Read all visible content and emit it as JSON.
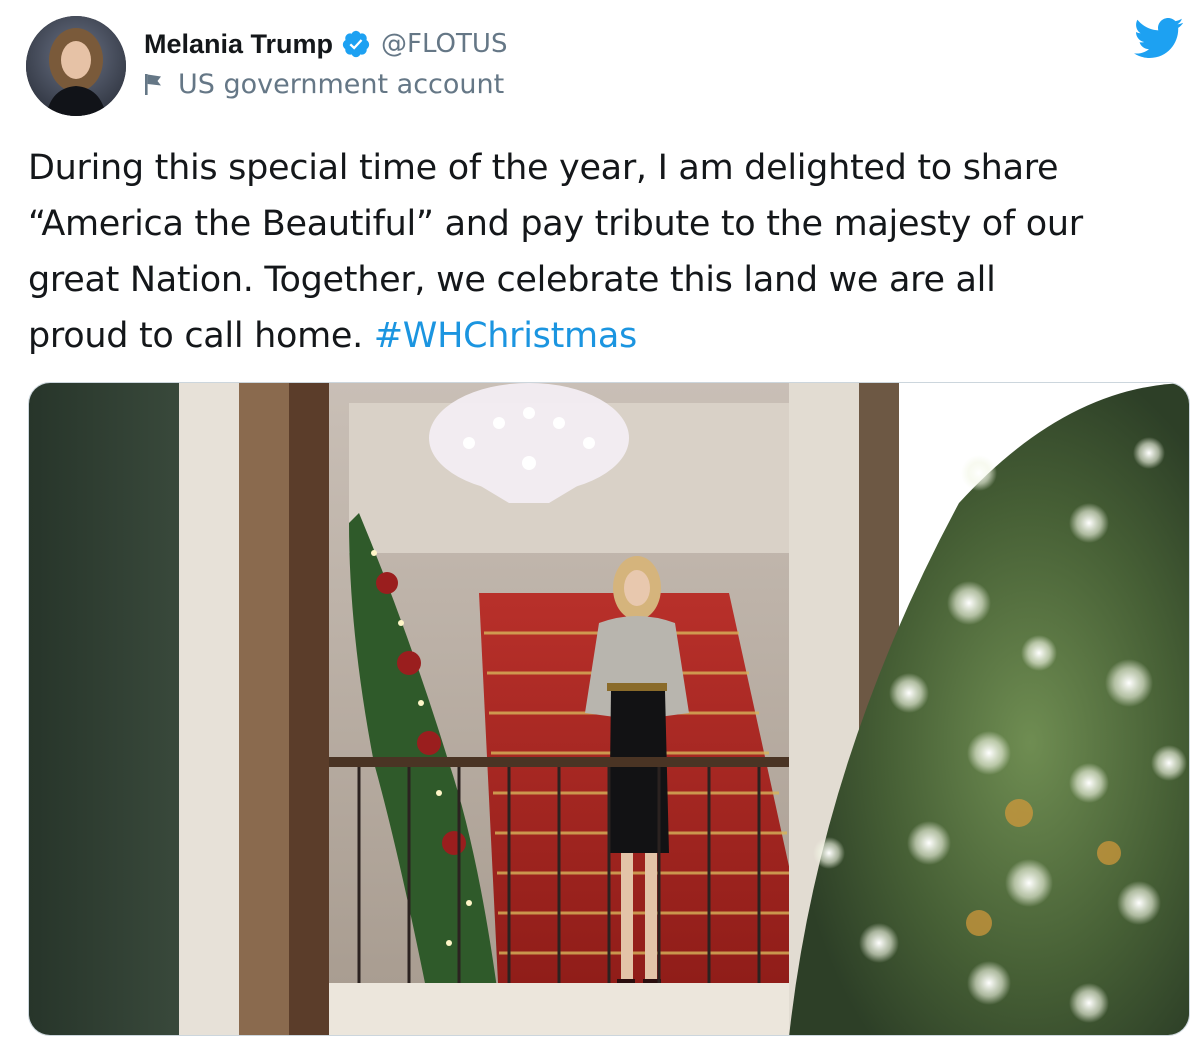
{
  "author": {
    "display_name": "Melania Trump",
    "handle": "@FLOTUS",
    "verified": true,
    "account_label": "US government account",
    "avatar": "avatar-photo"
  },
  "tweet": {
    "text_lines": [
      "During this special time of the year, I am delighted to share",
      "“America the Beautiful” and pay tribute to the majesty of our",
      "great Nation. Together, we celebrate this land we are all",
      "proud to call home. "
    ],
    "hashtag": "#WHChristmas"
  },
  "media": {
    "kind": "photo",
    "subject": "woman-on-grand-staircase"
  },
  "icons": {
    "verified": "verified-badge-icon",
    "flag": "flag-icon",
    "brand": "twitter-bird-icon"
  },
  "colors": {
    "brand_blue": "#1da1f2",
    "hashtag": "#1b95e0",
    "secondary_text": "#657786",
    "primary_text": "#14171a"
  }
}
